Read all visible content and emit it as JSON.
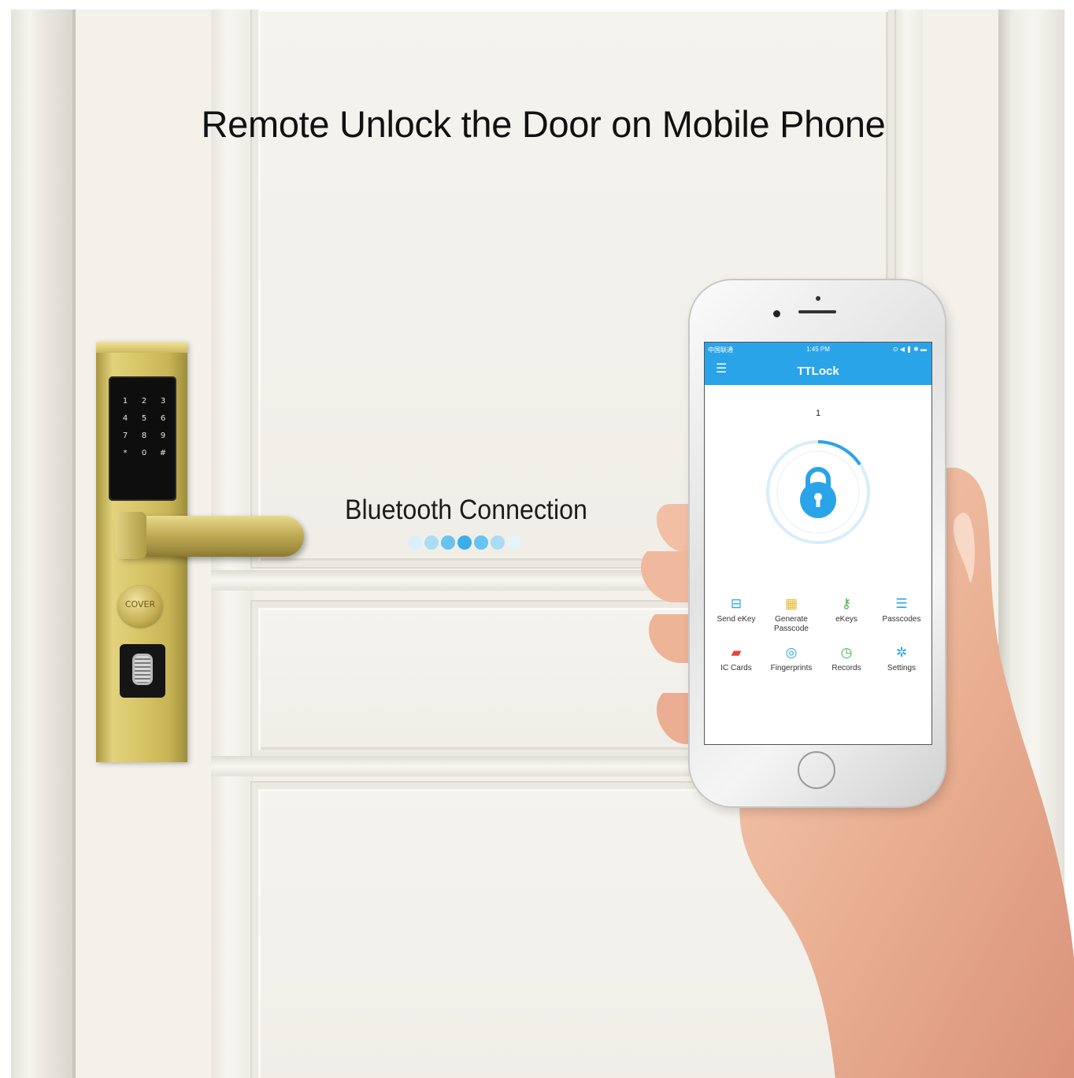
{
  "headline": "Remote Unlock the Door on Mobile Phone",
  "bluetooth_label": "Bluetooth Connection",
  "bluetooth_dots": [
    "#d9f0fb",
    "#a9dcf5",
    "#67c3ef",
    "#3aaeeb",
    "#67c3ef",
    "#a9dcf5",
    "#e4f4fb"
  ],
  "lock": {
    "keypad_keys": [
      "1",
      "2",
      "3",
      "4",
      "5",
      "6",
      "7",
      "8",
      "9",
      "*",
      "0",
      "#"
    ],
    "cover_label": "COVER"
  },
  "phone": {
    "status": {
      "carrier": "中国联通",
      "time": "1:45 PM",
      "icons": "⊙ ◀ ❚ ✱ ▬"
    },
    "app_title": "TTLock",
    "menu_icon": "hamburger-icon",
    "lock_name": "1",
    "accent": "#2aa4e8",
    "menu_items": [
      {
        "label": "Send eKey",
        "icon": "send-ekey-icon",
        "glyph": "⊟",
        "color": "#2aa4e8"
      },
      {
        "label": "Generate Passcode",
        "icon": "passcode-icon",
        "glyph": "▦",
        "color": "#e6b82e"
      },
      {
        "label": "eKeys",
        "icon": "ekeys-icon",
        "glyph": "⚷",
        "color": "#3db54a"
      },
      {
        "label": "Passcodes",
        "icon": "passcodes-icon",
        "glyph": "☰",
        "color": "#2aa4e8"
      },
      {
        "label": "IC Cards",
        "icon": "ic-card-icon",
        "glyph": "▰",
        "color": "#e2463a"
      },
      {
        "label": "Fingerprints",
        "icon": "fingerprint-icon",
        "glyph": "◎",
        "color": "#2aa4e8"
      },
      {
        "label": "Records",
        "icon": "records-icon",
        "glyph": "◷",
        "color": "#3db54a"
      },
      {
        "label": "Settings",
        "icon": "settings-icon",
        "glyph": "✲",
        "color": "#2aa4e8"
      }
    ]
  }
}
